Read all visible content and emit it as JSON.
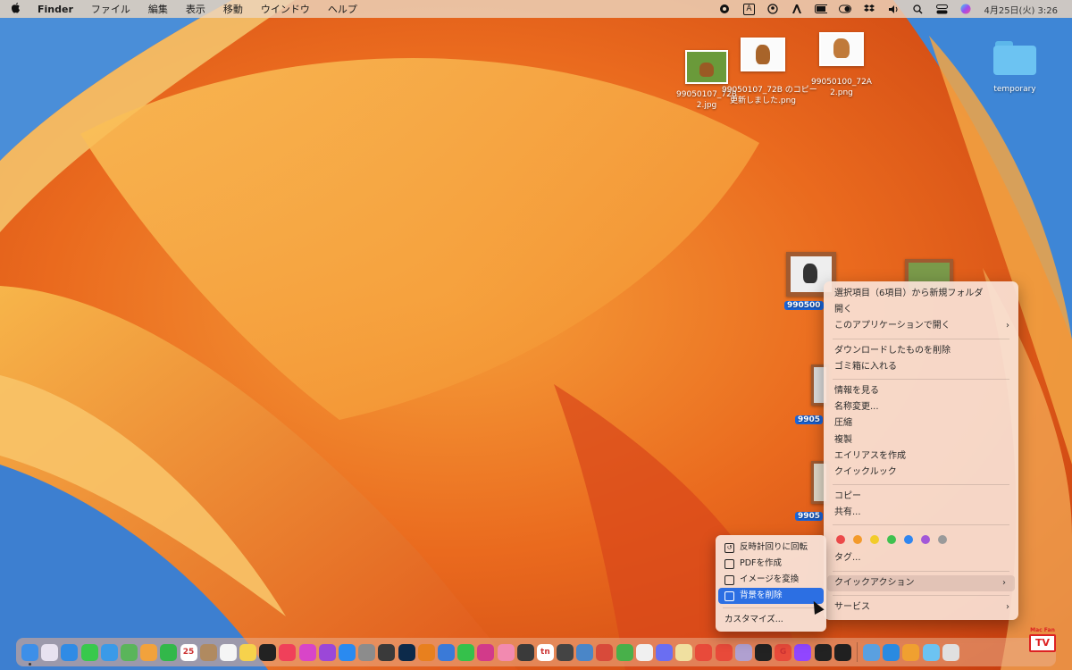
{
  "menubar": {
    "apple": "",
    "app_name": "Finder",
    "items": [
      "ファイル",
      "編集",
      "表示",
      "移動",
      "ウインドウ",
      "ヘルプ"
    ],
    "input_indicator": "A",
    "clock": "4月25日(火) 3:26"
  },
  "desktop_icons": [
    {
      "label": "99050107_72B 2.jpg"
    },
    {
      "label": "99050107_72B のコピー",
      "label2": "更新しました.png"
    },
    {
      "label": "99050100_72A 2.png"
    },
    {
      "label": "temporary"
    },
    {
      "label": "990500"
    },
    {
      "label": "9905"
    },
    {
      "label": "9905"
    }
  ],
  "context_menu": {
    "items": [
      "選択項目（6項目）から新規フォルダ",
      "開く",
      "このアプリケーションで開く",
      "ダウンロードしたものを削除",
      "ゴミ箱に入れる",
      "情報を見る",
      "名称変更...",
      "圧縮",
      "複製",
      "エイリアスを作成",
      "クイックルック",
      "コピー",
      "共有...",
      "タグ...",
      "クイックアクション",
      "サービス"
    ],
    "arrow": "›",
    "tag_colors": [
      "#ec4a4a",
      "#f39a2b",
      "#f2cc2a",
      "#3fc14f",
      "#2f86f0",
      "#a358d8",
      "#9a9a9a"
    ]
  },
  "submenu": {
    "items": [
      "反時計回りに回転",
      "PDFを作成",
      "イメージを変換",
      "背景を削除"
    ],
    "customize": "カスタマイズ..."
  },
  "dock": {
    "apps": [
      {
        "name": "finder",
        "color": "#3d8fe8",
        "running": true
      },
      {
        "name": "launchpad",
        "color": "#e8e2f0"
      },
      {
        "name": "safari",
        "color": "#2f8be5"
      },
      {
        "name": "messages",
        "color": "#38c94c"
      },
      {
        "name": "mail",
        "color": "#3a9ae8"
      },
      {
        "name": "maps",
        "color": "#5ab55a"
      },
      {
        "name": "photos",
        "color": "#f2a23c"
      },
      {
        "name": "facetime",
        "color": "#32b84a"
      },
      {
        "name": "calendar",
        "color": "#ffffff",
        "text": "25"
      },
      {
        "name": "contacts",
        "color": "#b08a60"
      },
      {
        "name": "reminders",
        "color": "#f5f5f5"
      },
      {
        "name": "notes",
        "color": "#f6d24c"
      },
      {
        "name": "appletv",
        "color": "#222222"
      },
      {
        "name": "music",
        "color": "#f0405a"
      },
      {
        "name": "itunes-store",
        "color": "#d845c8"
      },
      {
        "name": "podcasts",
        "color": "#9b47d8"
      },
      {
        "name": "app-store",
        "color": "#2a8af0"
      },
      {
        "name": "system-settings",
        "color": "#8c8c8c"
      },
      {
        "name": "final-cut",
        "color": "#3a3a3a"
      },
      {
        "name": "photoshop",
        "color": "#0c2a4a"
      },
      {
        "name": "blender",
        "color": "#e8801e"
      },
      {
        "name": "airmail",
        "color": "#3a7ad8"
      },
      {
        "name": "line",
        "color": "#35c14b"
      },
      {
        "name": "pixelmator",
        "color": "#d23a8a"
      },
      {
        "name": "sticky",
        "color": "#f28ab0"
      },
      {
        "name": "obs",
        "color": "#3a3a3a"
      },
      {
        "name": "typora",
        "color": "#ffffff",
        "text": "tn"
      },
      {
        "name": "keynote-remote",
        "color": "#444444"
      },
      {
        "name": "preview",
        "color": "#4a86c8"
      },
      {
        "name": "flashcards",
        "color": "#d84a3a"
      },
      {
        "name": "numbers",
        "color": "#48b04a"
      },
      {
        "name": "textedit",
        "color": "#f0f0f0"
      },
      {
        "name": "messenger",
        "color": "#6a6ef2"
      },
      {
        "name": "tes",
        "color": "#f0e0a0"
      },
      {
        "name": "chrome",
        "color": "#e84a3a"
      },
      {
        "name": "pdf-expert",
        "color": "#e84a3a"
      },
      {
        "name": "vectorworks",
        "color": "#b0a0d0"
      },
      {
        "name": "stocks",
        "color": "#222222"
      },
      {
        "name": "gmail",
        "color": "#e84a3a",
        "text": "G"
      },
      {
        "name": "twitch",
        "color": "#9146ff"
      },
      {
        "name": "terminal",
        "color": "#222222"
      },
      {
        "name": "capcut",
        "color": "#202020"
      }
    ],
    "right": [
      {
        "name": "airdrop-folder",
        "color": "#5aa0e0"
      },
      {
        "name": "screen-sharing",
        "color": "#2a8ae0"
      },
      {
        "name": "downloads-stack",
        "color": "#f0a030"
      },
      {
        "name": "folder",
        "color": "#6cc3f2"
      },
      {
        "name": "trash",
        "color": "#e0e0e0"
      }
    ]
  },
  "watermark": {
    "small": "Mac Fan",
    "big": "TV"
  }
}
